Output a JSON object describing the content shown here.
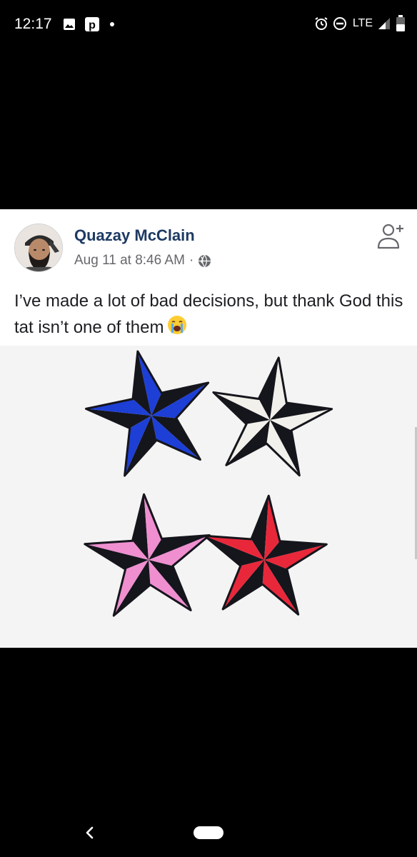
{
  "status_bar": {
    "time": "12:17",
    "left_icons": [
      "image-icon",
      "parking-app-icon",
      "notification-dot-icon"
    ],
    "right_icons": [
      "alarm-icon",
      "do-not-disturb-icon",
      "signal-icon",
      "battery-icon"
    ],
    "network": "LTE"
  },
  "post": {
    "author": "Quazay McClain",
    "timestamp": "Aug 11 at 8:46 AM",
    "separator": "·",
    "privacy_icon": "globe-icon",
    "text": "I’ve made a lot of bad decisions, but thank God this tat isn’t one of them",
    "emoji": "😭",
    "add_friend_icon": "add-friend-icon",
    "image": {
      "content": "nautical-stars-image",
      "stars": [
        {
          "color": "#1d3fd6",
          "position": "top-left"
        },
        {
          "color": "#f2f0ea",
          "position": "top-right"
        },
        {
          "color": "#ef8fd0",
          "position": "bottom-left"
        },
        {
          "color": "#e8283a",
          "position": "bottom-right"
        }
      ]
    }
  },
  "nav_bar": {
    "back_icon": "back-chevron-icon",
    "home_icon": "home-pill-icon"
  },
  "colors": {
    "background": "#000000",
    "card": "#ffffff",
    "author": "#1d3a63",
    "meta": "#65676b",
    "text": "#1c1e21"
  }
}
